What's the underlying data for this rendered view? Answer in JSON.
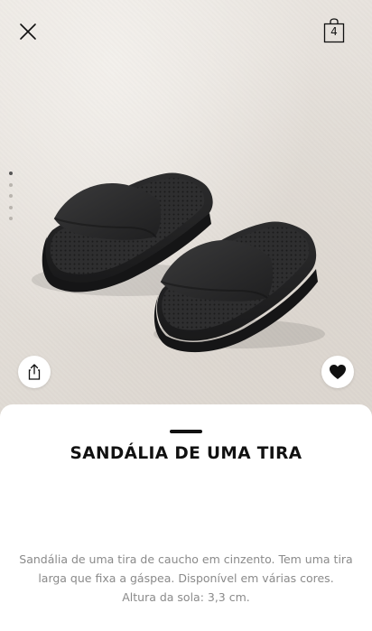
{
  "header": {
    "close_icon": "close-icon",
    "bag_icon": "shopping-bag-icon",
    "bag_count": "4"
  },
  "gallery": {
    "image_count": 5,
    "active_index": 0,
    "share_icon": "share-icon",
    "favorite_icon": "heart-icon"
  },
  "product": {
    "title": "SANDÁLIA DE UMA TIRA",
    "description_line1": "Sandália de uma tira de caucho em cinzento. Tem uma tira",
    "description_line2": "larga que fixa a gáspea. Disponível em várias cores.",
    "description_line3": "Altura da sola: 3,3 cm."
  },
  "colors": {
    "text": "#111111",
    "description": "#8a8a8a",
    "sandal": "#2b2b2c"
  }
}
